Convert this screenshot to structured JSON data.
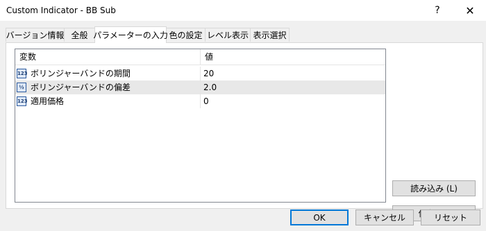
{
  "window": {
    "title": "Custom Indicator - BB Sub",
    "help_glyph": "?",
    "close_glyph": "✕"
  },
  "tabs": [
    {
      "label": "バージョン情報"
    },
    {
      "label": "全般"
    },
    {
      "label": "パラメーターの入力"
    },
    {
      "label": "色の設定"
    },
    {
      "label": "レベル表示"
    },
    {
      "label": "表示選択"
    }
  ],
  "active_tab": 2,
  "grid": {
    "col_variable": "変数",
    "col_value": "値",
    "rows": [
      {
        "icon": "123",
        "name": "ボリンジャーバンドの期間",
        "value": "20"
      },
      {
        "icon": "½",
        "name": "ボリンジャーバンドの偏差",
        "value": "2.0"
      },
      {
        "icon": "123",
        "name": "適用価格",
        "value": "0"
      }
    ]
  },
  "buttons": {
    "load": "読み込み (L)",
    "save": "保存 (S)",
    "ok": "OK",
    "cancel": "キャンセル",
    "reset": "リセット"
  }
}
